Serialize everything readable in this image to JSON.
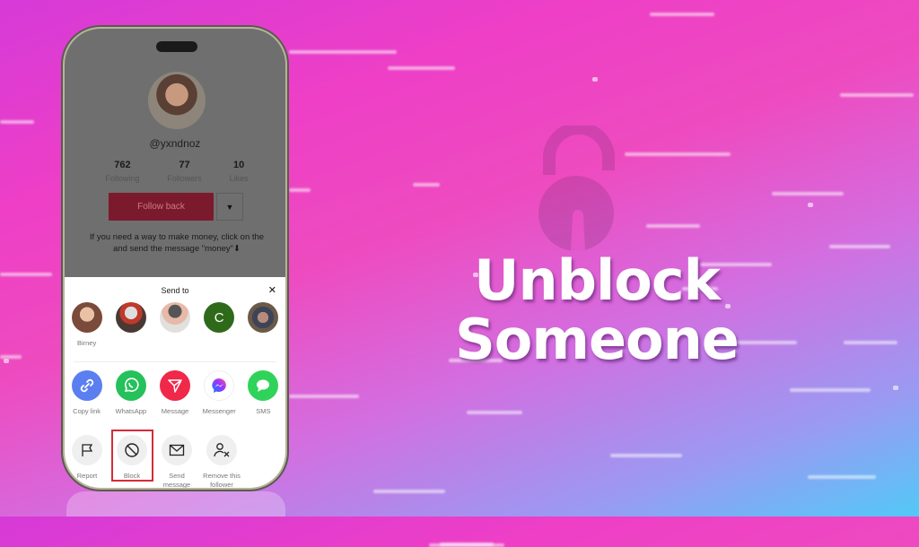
{
  "headline": {
    "line1": "Unblock",
    "line2": "Someone"
  },
  "profile": {
    "username": "@yxndnoz",
    "stats": [
      {
        "value": "762",
        "label": "Following"
      },
      {
        "value": "77",
        "label": "Followers"
      },
      {
        "value": "10",
        "label": "Likes"
      }
    ],
    "follow_button": "Follow back",
    "dropdown_icon": "▼",
    "bio": "If you need a way to make money, click on the and send the message \"money\"⬇"
  },
  "share_sheet": {
    "title": "Send to",
    "close_icon": "✕",
    "contacts": [
      {
        "name": "Birney",
        "initial": "",
        "color": "#a07a66"
      },
      {
        "name": "",
        "initial": "",
        "color": "#6b4a44"
      },
      {
        "name": "",
        "initial": "",
        "color": "#9b9b94"
      },
      {
        "name": "",
        "initial": "C",
        "color": "#2f6a1b"
      },
      {
        "name": "",
        "initial": "",
        "color": "#5a4f48"
      }
    ],
    "share_options": [
      {
        "label": "Copy link",
        "icon": "link-icon",
        "color": "#5b7ff0"
      },
      {
        "label": "WhatsApp",
        "icon": "whatsapp-icon",
        "color": "#25c15a"
      },
      {
        "label": "Message",
        "icon": "send-icon",
        "color": "#f0284a"
      },
      {
        "label": "Messenger",
        "icon": "messenger-icon",
        "color": "#ffffff"
      },
      {
        "label": "SMS",
        "icon": "sms-icon",
        "color": "#2fd35a"
      }
    ],
    "actions": [
      {
        "label": "Report",
        "icon": "flag-icon"
      },
      {
        "label": "Block",
        "icon": "block-icon",
        "highlighted": true
      },
      {
        "label": "Send message",
        "icon": "mail-icon"
      },
      {
        "label": "Remove this follower",
        "icon": "remove-user-icon"
      }
    ],
    "highlight_color": "#d42b3a"
  }
}
